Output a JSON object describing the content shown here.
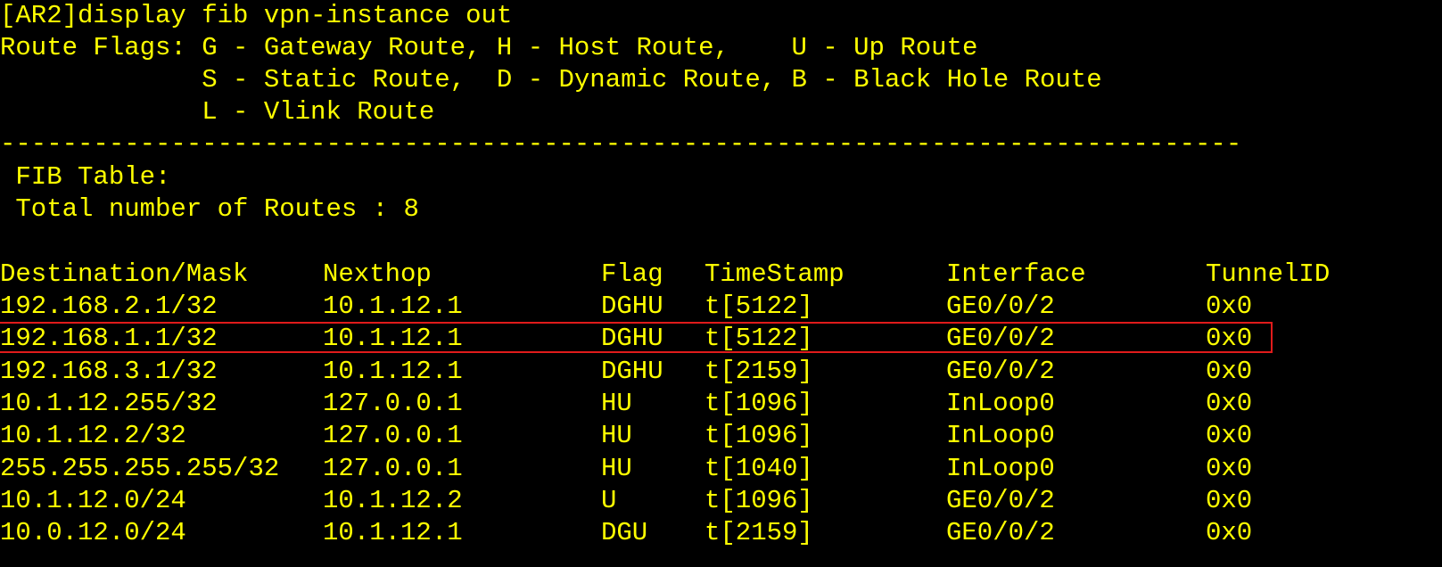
{
  "terminal": {
    "command_line": "[AR2]display fib vpn-instance out",
    "flags": {
      "line1": "Route Flags: G - Gateway Route, H - Host Route,    U - Up Route",
      "line2": "             S - Static Route,  D - Dynamic Route, B - Black Hole Route",
      "line3": "             L - Vlink Route"
    },
    "separator": "--------------------------------------------------------------------------------",
    "fib_table_label": " FIB Table:",
    "total_routes": " Total number of Routes : 8",
    "columns": [
      "Destination/Mask",
      "Nexthop",
      "Flag",
      "TimeStamp",
      "Interface",
      "TunnelID"
    ],
    "rows": [
      [
        "192.168.2.1/32",
        "10.1.12.1",
        "DGHU",
        "t[5122]",
        "GE0/0/2",
        "0x0"
      ],
      [
        "192.168.1.1/32",
        "10.1.12.1",
        "DGHU",
        "t[5122]",
        "GE0/0/2",
        "0x0"
      ],
      [
        "192.168.3.1/32",
        "10.1.12.1",
        "DGHU",
        "t[2159]",
        "GE0/0/2",
        "0x0"
      ],
      [
        "10.1.12.255/32",
        "127.0.0.1",
        "HU",
        "t[1096]",
        "InLoop0",
        "0x0"
      ],
      [
        "10.1.12.2/32",
        "127.0.0.1",
        "HU",
        "t[1096]",
        "InLoop0",
        "0x0"
      ],
      [
        "255.255.255.255/32",
        "127.0.0.1",
        "HU",
        "t[1040]",
        "InLoop0",
        "0x0"
      ],
      [
        "10.1.12.0/24",
        "10.1.12.2",
        "U",
        "t[1096]",
        "GE0/0/2",
        "0x0"
      ],
      [
        "10.0.12.0/24",
        "10.1.12.1",
        "DGU",
        "t[2159]",
        "GE0/0/2",
        "0x0"
      ]
    ],
    "highlighted_row_index": 1,
    "colors": {
      "background": "#000000",
      "text": "#ffff00",
      "highlight_border": "#e01b1b"
    }
  }
}
